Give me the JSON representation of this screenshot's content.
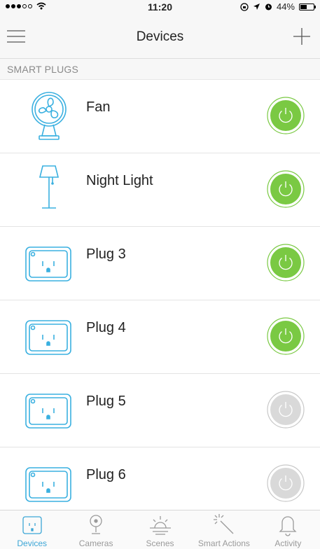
{
  "status_bar": {
    "time": "11:20",
    "battery_text": "44%"
  },
  "nav": {
    "title": "Devices"
  },
  "section": {
    "header": "SMART PLUGS"
  },
  "devices": [
    {
      "name": "Fan",
      "icon": "fan-icon",
      "power": "on"
    },
    {
      "name": "Night Light",
      "icon": "lamp-icon",
      "power": "on"
    },
    {
      "name": "Plug 3",
      "icon": "plug-icon",
      "power": "on"
    },
    {
      "name": "Plug 4",
      "icon": "plug-icon",
      "power": "on"
    },
    {
      "name": "Plug 5",
      "icon": "plug-icon",
      "power": "off"
    },
    {
      "name": "Plug 6",
      "icon": "plug-icon",
      "power": "off"
    }
  ],
  "tabs": [
    {
      "label": "Devices",
      "icon": "plug-icon",
      "active": true
    },
    {
      "label": "Cameras",
      "icon": "camera-icon",
      "active": false
    },
    {
      "label": "Scenes",
      "icon": "sunrise-icon",
      "active": false
    },
    {
      "label": "Smart Actions",
      "icon": "magic-wand-icon",
      "active": false
    },
    {
      "label": "Activity",
      "icon": "bell-icon",
      "active": false
    }
  ],
  "colors": {
    "accent": "#3ca6d6",
    "power_on": "#7ac943",
    "power_off": "#d9d9d9",
    "icon_stroke": "#3ab0e0"
  }
}
